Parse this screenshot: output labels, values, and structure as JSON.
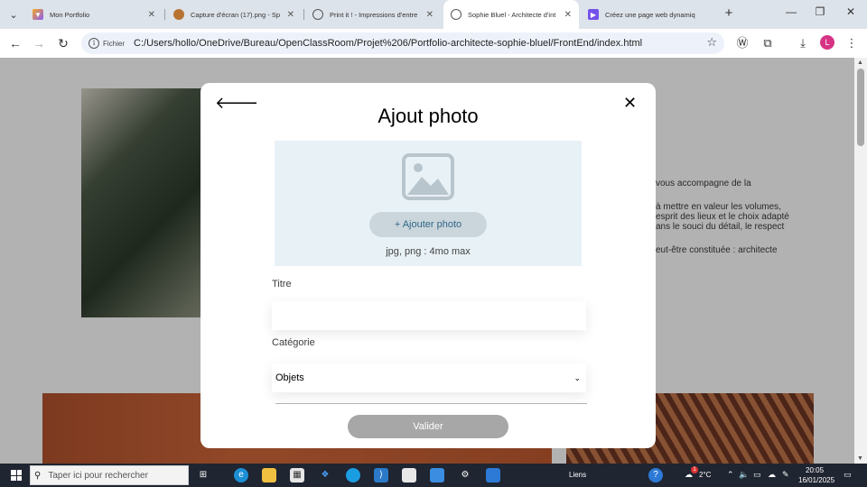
{
  "browser": {
    "tabs": [
      {
        "title": "Mon Portfolio",
        "favicon": "vercel-icon",
        "active": false
      },
      {
        "title": "Capture d'écran (17).png - Sp",
        "favicon": "image-icon",
        "active": false
      },
      {
        "title": "Print it ! - Impressions d'entre",
        "favicon": "globe-icon",
        "active": false
      },
      {
        "title": "Sophie Bluel - Architecte d'int",
        "favicon": "globe-icon",
        "active": true
      },
      {
        "title": "Créez une page web dynamiq",
        "favicon": "openclassrooms-icon",
        "active": false
      }
    ],
    "address": {
      "chip": "Fichier",
      "url": "C:/Users/hollo/OneDrive/Bureau/OpenClassRoom/Projet%206/Portfolio-architecte-sophie-bluel/FrontEnd/index.html"
    },
    "profile_initial": "L"
  },
  "background_page": {
    "text_lines": [
      "vous accompagne de la",
      "à mettre en valeur les volumes,",
      "esprit des lieux et le choix adapté",
      "ans le souci du détail, le respect",
      "eut-être constituée : architecte"
    ]
  },
  "modal": {
    "title": "Ajout photo",
    "upload_button": "+ Ajouter photo",
    "upload_hint": "jpg, png : 4mo max",
    "title_label": "Titre",
    "title_value": "",
    "category_label": "Catégorie",
    "category_value": "Objets",
    "submit_label": "Valider"
  },
  "taskbar": {
    "search_placeholder": "Taper ici pour rechercher",
    "links_label": "Liens",
    "weather_badge": "1",
    "temperature": "2°C",
    "time": "20:05",
    "date": "16/01/2025"
  },
  "colors": {
    "upload_zone": "#e8f1f6",
    "upload_button_bg": "#cbd6dc",
    "upload_button_text": "#306685",
    "submit_bg": "#a7a7a7",
    "taskbar": "#1f2531"
  }
}
